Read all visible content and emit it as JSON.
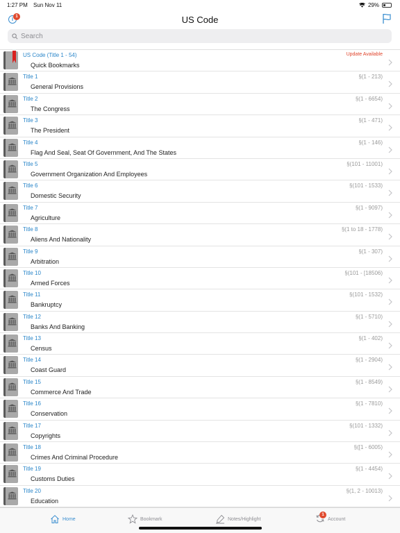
{
  "status": {
    "time": "1:27 PM",
    "date": "Sun Nov 11",
    "battery": "29%"
  },
  "header": {
    "title": "US Code",
    "info_badge": "1"
  },
  "search": {
    "placeholder": "Search"
  },
  "items": [
    {
      "title": "US Code (Title 1 - 54)",
      "subtitle": "Quick Bookmarks",
      "range": "",
      "update": "Update Available",
      "bookmark": true
    },
    {
      "title": "Title 1",
      "subtitle": "General Provisions",
      "range": "§(1 - 213)"
    },
    {
      "title": "Title 2",
      "subtitle": "The Congress",
      "range": "§(1 - 6654)"
    },
    {
      "title": "Title 3",
      "subtitle": "The President",
      "range": "§(1 - 471)"
    },
    {
      "title": "Title 4",
      "subtitle": "Flag And Seal, Seat Of Government, And The States",
      "range": "§(1 - 146)"
    },
    {
      "title": "Title 5",
      "subtitle": "Government Organization And Employees",
      "range": "§(101 - 11001)"
    },
    {
      "title": "Title 6",
      "subtitle": "Domestic Security",
      "range": "§(101 - 1533)"
    },
    {
      "title": "Title 7",
      "subtitle": "Agriculture",
      "range": "§(1 - 9097)"
    },
    {
      "title": "Title 8",
      "subtitle": "Aliens And Nationality",
      "range": "§(1 to 18 - 1778)"
    },
    {
      "title": "Title 9",
      "subtitle": "Arbitration",
      "range": "§(1 - 307)"
    },
    {
      "title": "Title 10",
      "subtitle": "Armed Forces",
      "range": "§(101 - [18506)"
    },
    {
      "title": "Title 11",
      "subtitle": "Bankruptcy",
      "range": "§(101 - 1532)"
    },
    {
      "title": "Title 12",
      "subtitle": "Banks And Banking",
      "range": "§(1 - 5710)"
    },
    {
      "title": "Title 13",
      "subtitle": "Census",
      "range": "§(1 - 402)"
    },
    {
      "title": "Title 14",
      "subtitle": "Coast Guard",
      "range": "§(1 - 2904)"
    },
    {
      "title": "Title 15",
      "subtitle": "Commerce And Trade",
      "range": "§(1 - 8549)"
    },
    {
      "title": "Title 16",
      "subtitle": "Conservation",
      "range": "§(1 - 7810)"
    },
    {
      "title": "Title 17",
      "subtitle": "Copyrights",
      "range": "§(101 - 1332)"
    },
    {
      "title": "Title 18",
      "subtitle": "Crimes And Criminal Procedure",
      "range": "§([1 - 6005)"
    },
    {
      "title": "Title 19",
      "subtitle": "Customs Duties",
      "range": "§(1 - 4454)"
    },
    {
      "title": "Title 20",
      "subtitle": "Education",
      "range": "§(1, 2 - 10013)"
    }
  ],
  "tabs": {
    "home": "Home",
    "bookmark": "Bookmark",
    "notes": "Notes/Highlight",
    "account": "Account",
    "account_badge": "1"
  },
  "colors": {
    "accent": "#3a8ed0",
    "update": "#e0442b",
    "badge": "#e04a2e"
  }
}
